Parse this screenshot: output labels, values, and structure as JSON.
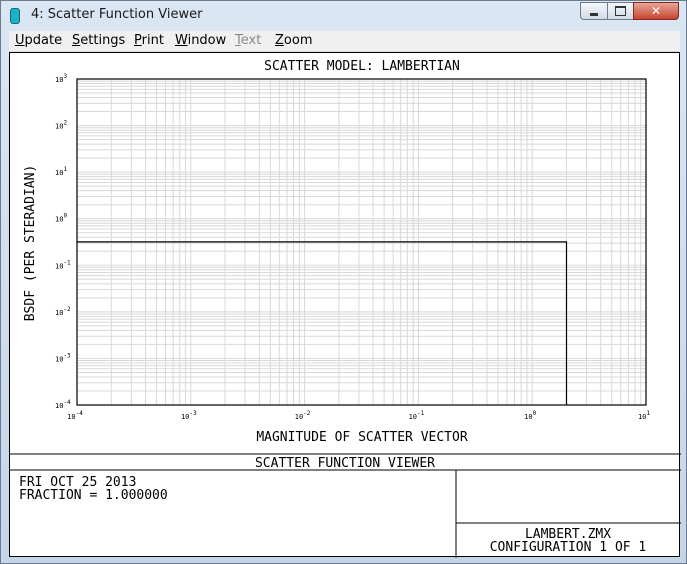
{
  "window": {
    "title": "4: Scatter Function Viewer"
  },
  "menu": [
    {
      "label": "Update",
      "key": "U",
      "rest": "pdate",
      "enabled": true
    },
    {
      "label": "Settings",
      "key": "S",
      "rest": "ettings",
      "enabled": true
    },
    {
      "label": "Print",
      "key": "P",
      "rest": "rint",
      "enabled": true
    },
    {
      "label": "Window",
      "key": "W",
      "rest": "indow",
      "enabled": true
    },
    {
      "label": "Text",
      "key": "T",
      "rest": "ext",
      "enabled": false
    },
    {
      "label": "Zoom",
      "key": "Z",
      "rest": "oom",
      "enabled": true
    }
  ],
  "plot": {
    "title": "SCATTER MODEL: LAMBERTIAN",
    "xlabel": "MAGNITUDE OF SCATTER VECTOR",
    "ylabel": "BSDF (PER STERADIAN)"
  },
  "chart_data": {
    "type": "line",
    "title": "SCATTER MODEL: LAMBERTIAN",
    "xlabel": "MAGNITUDE OF SCATTER VECTOR",
    "ylabel": "BSDF (PER STERADIAN)",
    "x_scale": "log",
    "y_scale": "log",
    "xlim": [
      0.0001,
      10
    ],
    "ylim": [
      0.0001,
      1000
    ],
    "x_ticks": [
      -4,
      -3,
      -2,
      -1,
      0,
      1
    ],
    "y_ticks": [
      -4,
      -3,
      -2,
      -1,
      0,
      1,
      2,
      3
    ],
    "grid": true,
    "series": [
      {
        "x": [
          0.0001,
          2.0,
          2.0
        ],
        "y": [
          0.3183,
          0.3183,
          0.0001
        ]
      }
    ]
  },
  "footer": {
    "banner": "SCATTER FUNCTION VIEWER",
    "date": "FRI OCT 25 2013",
    "fraction": "FRACTION = 1.000000",
    "file": "LAMBERT.ZMX",
    "config": "CONFIGURATION 1 OF 1"
  },
  "colors": {
    "ink": "#000000",
    "grid": "#d8d8d8",
    "titlebar": "#c5d5e8",
    "close": "#c8452f"
  }
}
